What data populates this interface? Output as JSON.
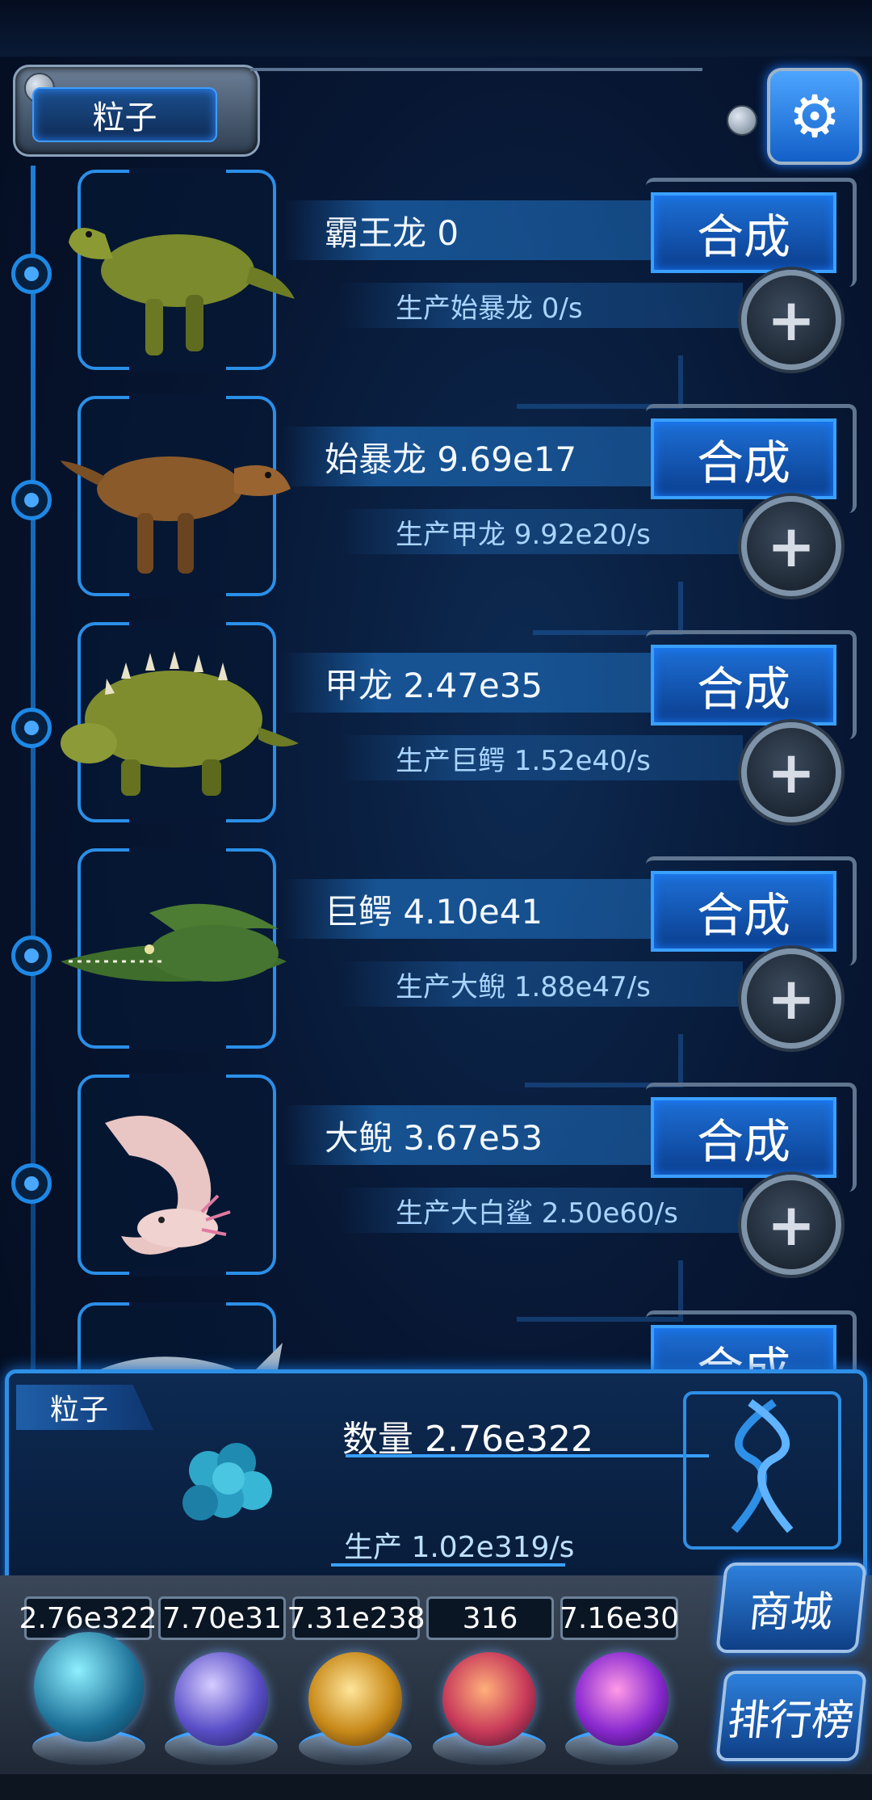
{
  "header": {
    "title": "粒子"
  },
  "creatures": [
    {
      "name_line": "霸王龙 0",
      "prod_line": "生产始暴龙 0/s",
      "synth_label": "合成",
      "plus_label": "+"
    },
    {
      "name_line": "始暴龙 9.69e17",
      "prod_line": "生产甲龙 9.92e20/s",
      "synth_label": "合成",
      "plus_label": "+"
    },
    {
      "name_line": "甲龙 2.47e35",
      "prod_line": "生产巨鳄 1.52e40/s",
      "synth_label": "合成",
      "plus_label": "+"
    },
    {
      "name_line": "巨鳄 4.10e41",
      "prod_line": "生产大鲵 1.88e47/s",
      "synth_label": "合成",
      "plus_label": "+"
    },
    {
      "name_line": "大鲵 3.67e53",
      "prod_line": "生产大白鲨 2.50e60/s",
      "synth_label": "合成",
      "plus_label": "+"
    }
  ],
  "partial_row": {
    "synth_label": "合成"
  },
  "panel": {
    "tag": "粒子",
    "count": "数量 2.76e322",
    "production": "生产 1.02e319/s"
  },
  "resources": [
    "2.76e322",
    "7.70e31",
    "7.31e238",
    "316",
    "7.16e30"
  ],
  "side_buttons": {
    "shop": "商城",
    "ranking": "排行榜"
  },
  "icons": {
    "settings": "gear-icon",
    "plus": "plus-icon"
  },
  "colors": {
    "accent": "#2e8fe6",
    "button": "#1d6fd6",
    "background": "#071632"
  }
}
